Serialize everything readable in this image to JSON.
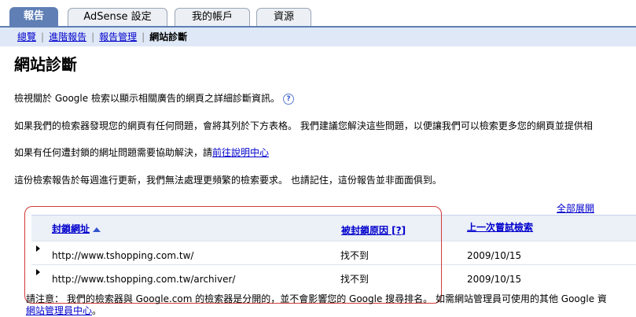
{
  "tabs": [
    {
      "label": "報告",
      "active": true
    },
    {
      "label": "AdSense 設定",
      "active": false
    },
    {
      "label": "我的帳戶",
      "active": false
    },
    {
      "label": "資源",
      "active": false
    }
  ],
  "subnav": {
    "items": [
      "總覽",
      "進階報告",
      "報告管理"
    ],
    "current": "網站診斷"
  },
  "page_title": "網站診斷",
  "intro": {
    "text": "檢視關於 Google 檢索以顯示相關廣告的網頁之詳細診斷資訊。",
    "help_icon": "question-circle-icon",
    "help_glyph": "?"
  },
  "para2": "如果我們的檢索器發現您的網頁有任何問題，會將其列於下方表格。 我們建議您解決這些問題，以便讓我們可以檢索更多您的網頁並提供相",
  "para3": {
    "text": "如果有任何遭封鎖的網址問題需要協助解決，請",
    "link": "前往說明中心"
  },
  "para4": "這份檢索報告於每週進行更新，我們無法處理更頻繁的檢索要求。 也請記住，這份報告並非面面俱到。",
  "expand_all": "全部展開",
  "table": {
    "headers": {
      "url": "封鎖網址",
      "reason": "被封鎖原因 [",
      "reason_help": "?",
      "reason_close": "]",
      "last_try": "上一次嘗試檢索"
    },
    "rows": [
      {
        "url": "http://www.tshopping.com.tw/",
        "reason": "找不到",
        "date": "2009/10/15"
      },
      {
        "url": "http://www.tshopping.com.tw/archiver/",
        "reason": "找不到",
        "date": "2009/10/15"
      }
    ]
  },
  "note": {
    "text": "請注意： 我們的檢索器與 Google.com 的檢索器是分開的，並不會影響您的 Google 搜尋排名。 如需網站管理員可使用的其他 Google 資",
    "link": "網站管理員中心",
    "tail": "。"
  }
}
